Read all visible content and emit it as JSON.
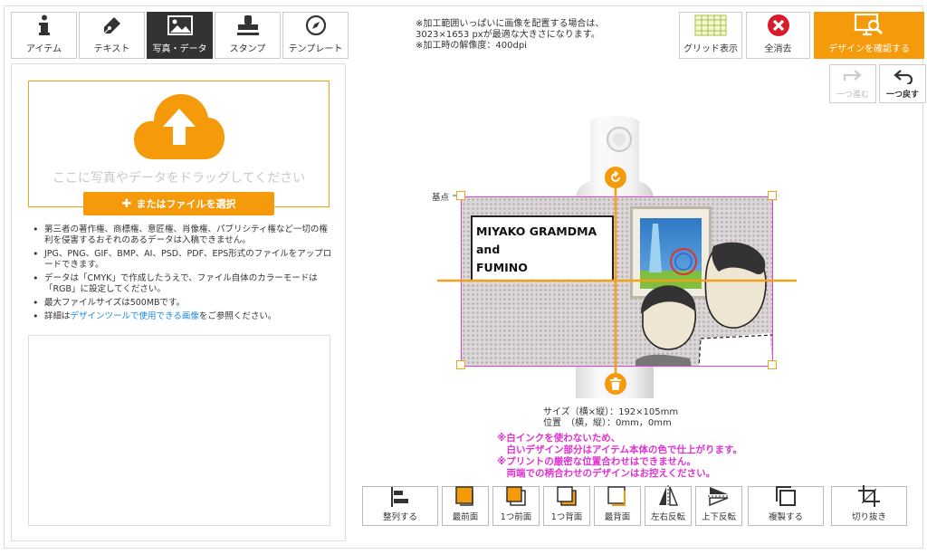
{
  "tabs": [
    {
      "label": "アイテム",
      "icon": "info-icon"
    },
    {
      "label": "テキスト",
      "icon": "pen-icon"
    },
    {
      "label": "写真・データ",
      "icon": "image-icon",
      "active": true
    },
    {
      "label": "スタンプ",
      "icon": "stamp-icon"
    },
    {
      "label": "テンプレート",
      "icon": "compass-icon"
    }
  ],
  "upload": {
    "drop_text": "ここに写真やデータをドラッグしてください",
    "select_button": "またはファイルを選択"
  },
  "notes": [
    "第三者の著作権、商標権、意匠権、肖像権、パブリシティ権など一切の権利を侵害するおそれのあるデータは入稿できません。",
    "JPG、PNG、GIF、BMP、AI、PSD、PDF、EPS形式のファイルをアップロードできます。",
    "データは「CMYK」で作成したうえで、ファイル自体のカラーモードは「RGB」に設定してください。",
    "最大ファイルサイズは500MBです。"
  ],
  "note_link": {
    "prefix": "詳細は",
    "link": "デザインツールで使用できる画像",
    "suffix": "をご参照ください。"
  },
  "top_note": [
    "※加工範囲いっぱいに画像を配置する場合は、",
    "3023×1653 pxが最適な大きさになります。",
    "※加工時の解像度：400dpi"
  ],
  "top_buttons": {
    "grid": "グリッド表示",
    "clear": "全消去",
    "confirm": "デザインを確認する"
  },
  "history": {
    "redo": "一つ進む",
    "undo": "一つ戻す"
  },
  "canvas": {
    "origin_label": "基点",
    "text_lines": [
      "MIYAKO GRAMDMA",
      "and",
      "FUMINO"
    ]
  },
  "size_info": [
    "サイズ（横×縦）：192×105mm",
    "位置　（横，縦）：0mm，0mm"
  ],
  "warnings": [
    "※白インクを使わないため、",
    "　白いデザイン部分はアイテム本体の色で仕上がります。",
    "※プリントの厳密な位置合わせはできません。",
    "　両端での柄合わせのデザインはお控えください。"
  ],
  "bottom_buttons": {
    "align": "整列する",
    "front_most": "最前面",
    "forward": "1つ前面",
    "backward": "1つ背面",
    "back_most": "最背面",
    "flip_h": "左右反転",
    "flip_v": "上下反転",
    "duplicate": "複製する",
    "crop": "切り抜き"
  },
  "colors": {
    "accent": "#f59a0a",
    "selection": "#e040e0",
    "warning": "#e030d0",
    "link": "#1a8ae0"
  }
}
